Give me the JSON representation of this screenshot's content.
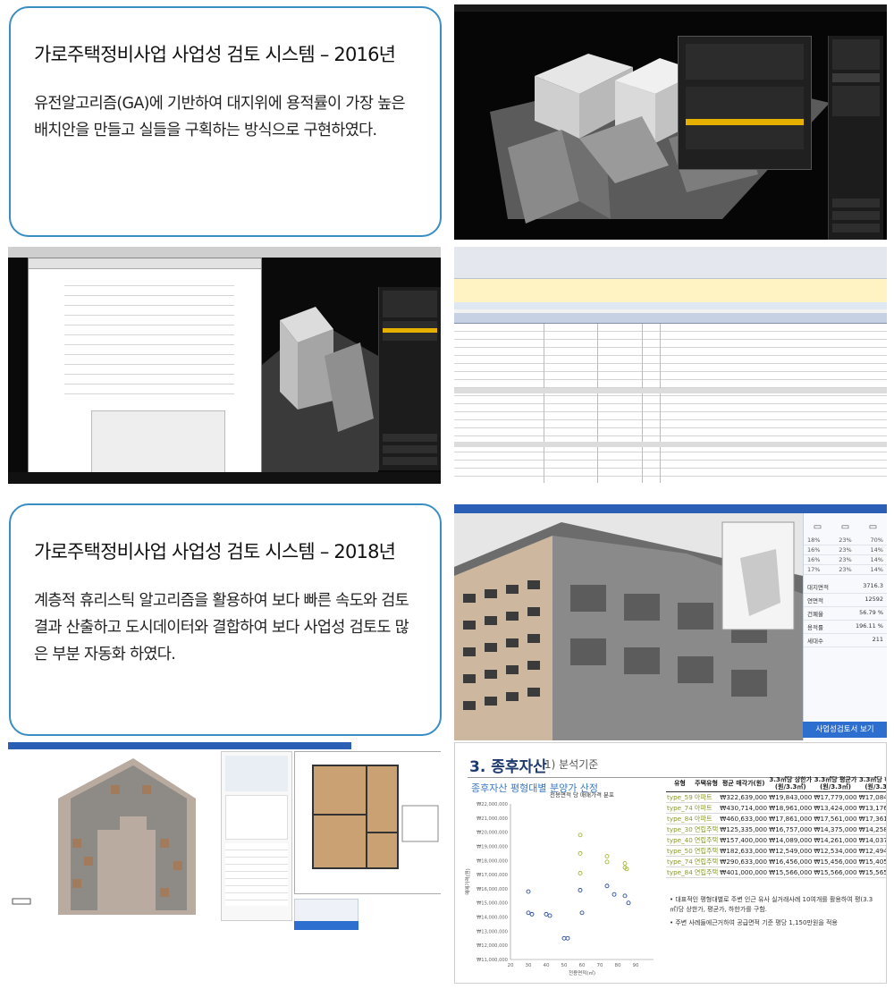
{
  "card_2016": {
    "title": "가로주택정비사업 사업성 검토 시스템 – 2016년",
    "body": "유전알고리즘(GA)에 기반하여 대지위에 용적률이 가장 높은 배치안을 만들고 실들을 구획하는 방식으로 구현하였다."
  },
  "card_2018": {
    "title": "가로주택정비사업 사업성 검토 시스템 – 2018년",
    "body": "계층적 휴리스틱 알고리즘을 활용하여 보다 빠른 속도와 검토결과 산출하고 도시데이터와 결합하여 보다 사업성 검토도 많은 부분 자동화 하였다."
  },
  "panel4": {
    "button": "사업성검토서 보기",
    "ratios": [
      {
        "a": "18%",
        "b": "23%",
        "c": "70%"
      },
      {
        "a": "16%",
        "b": "23%",
        "c": "14%"
      },
      {
        "a": "16%",
        "b": "23%",
        "c": "14%"
      },
      {
        "a": "17%",
        "b": "23%",
        "c": "14%"
      }
    ],
    "stats": [
      {
        "k": "대지면적",
        "v": "3716.3"
      },
      {
        "k": "연면적",
        "v": "12592"
      },
      {
        "k": "건폐율",
        "v": "56.79 %"
      },
      {
        "k": "용적률",
        "v": "196.11 %"
      },
      {
        "k": "세대수",
        "v": "211"
      }
    ]
  },
  "panel6": {
    "title": "3. 종후자산",
    "subtitle": "1) 분석기준",
    "chart_title": "종후자산 평형대별 분양가 산정",
    "table_headers": [
      "유형",
      "주택유형",
      "평균 매각가(원)",
      "3.3㎡당 상한가(원/3.3㎡)",
      "3.3㎡당 평균가(원/3.3㎡)",
      "3.3㎡당 하한가(원/3.3㎡)"
    ],
    "rows": [
      [
        "type_59",
        "아파트",
        "₩322,639,000",
        "₩19,843,000",
        "₩17,779,000",
        "₩17,084,000"
      ],
      [
        "type_74",
        "아파트",
        "₩430,714,000",
        "₩18,961,000",
        "₩13,424,000",
        "₩13,176,000"
      ],
      [
        "type_84",
        "아파트",
        "₩460,633,000",
        "₩17,861,000",
        "₩17,561,000",
        "₩17,361,000"
      ],
      [
        "type_30",
        "연립주택",
        "₩125,335,000",
        "₩16,757,000",
        "₩14,375,000",
        "₩14,258,000"
      ],
      [
        "type_40",
        "연립주택",
        "₩157,400,000",
        "₩14,089,000",
        "₩14,261,000",
        "₩14,037,000"
      ],
      [
        "type_50",
        "연립주택",
        "₩182,633,000",
        "₩12,549,000",
        "₩12,534,000",
        "₩12,494,000"
      ],
      [
        "type_74",
        "연립주택",
        "₩290,633,000",
        "₩16,456,000",
        "₩15,456,000",
        "₩15,405,000"
      ],
      [
        "type_84",
        "연립주택",
        "₩401,000,000",
        "₩15,566,000",
        "₩15,566,000",
        "₩15,565,000"
      ]
    ],
    "notes": [
      "대표적인 평형대별로 주변 인근 유사 실거래사례 10여개를 활용하여 평(3.3㎡)당 상한가, 평균가, 하한가를 구함.",
      "주변 사례들에근거하여 공급면적 기준 평당 1,150만원을 적용"
    ]
  },
  "chart_data": {
    "type": "scatter",
    "title": "전용면적 당 매매가격 분포",
    "xlabel": "전용면적(㎡)",
    "ylabel": "매매가격(원)",
    "xlim": [
      20,
      100
    ],
    "ylim": [
      11000000,
      22000000
    ],
    "yticks": [
      "₩11,000,000",
      "₩12,000,000",
      "₩13,000,000",
      "₩14,000,000",
      "₩15,000,000",
      "₩16,000,000",
      "₩17,000,000",
      "₩18,000,000",
      "₩19,000,000",
      "₩20,000,000",
      "₩21,000,000",
      "₩22,000,000"
    ],
    "xticks": [
      "20",
      "30",
      "40",
      "50",
      "60",
      "70",
      "80",
      "90"
    ],
    "series": [
      {
        "color": "#a7b83a",
        "points": [
          [
            59,
            19800000
          ],
          [
            59,
            18500000
          ],
          [
            59,
            17100000
          ],
          [
            74,
            17900000
          ],
          [
            74,
            18300000
          ],
          [
            84,
            17500000
          ],
          [
            84,
            17800000
          ],
          [
            85,
            17400000
          ]
        ]
      },
      {
        "color": "#2d4e9b",
        "points": [
          [
            30,
            15800000
          ],
          [
            30,
            14300000
          ],
          [
            32,
            14200000
          ],
          [
            40,
            14200000
          ],
          [
            42,
            14100000
          ],
          [
            50,
            12500000
          ],
          [
            52,
            12500000
          ],
          [
            74,
            16200000
          ],
          [
            78,
            15600000
          ],
          [
            84,
            15500000
          ],
          [
            86,
            15000000
          ],
          [
            60,
            14300000
          ],
          [
            59,
            15900000
          ]
        ]
      }
    ]
  }
}
